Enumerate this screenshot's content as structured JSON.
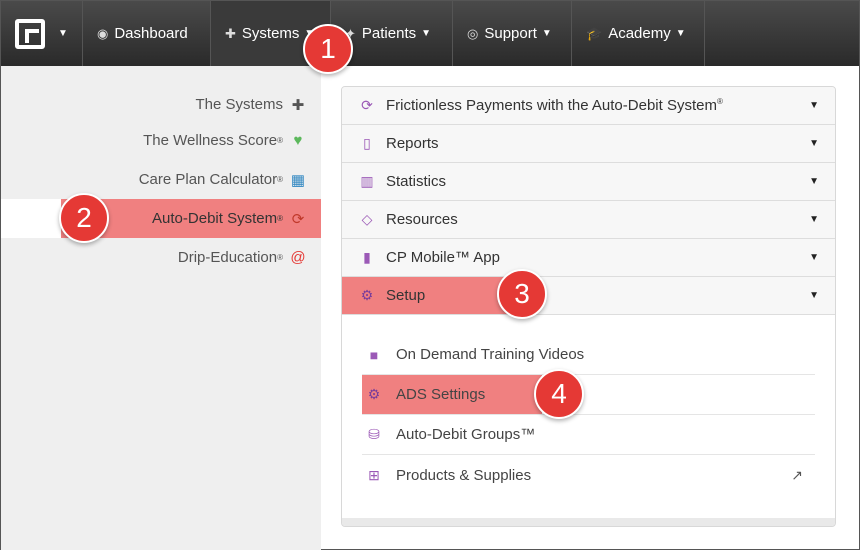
{
  "topnav": {
    "items": [
      {
        "icon": "dashboard-icon",
        "label": "Dashboard"
      },
      {
        "icon": "puzzle-icon",
        "label": "Systems"
      },
      {
        "icon": "people-icon",
        "label": "Patients"
      },
      {
        "icon": "lifebuoy-icon",
        "label": "Support"
      },
      {
        "icon": "graduation-cap-icon",
        "label": "Academy"
      }
    ]
  },
  "sidebar": {
    "items": [
      {
        "label": "The Systems",
        "icon": "puzzle-icon",
        "icon_color": "#555555"
      },
      {
        "label": "The Wellness Score",
        "icon": "heartbeat-icon",
        "icon_color": "#5cb85c"
      },
      {
        "label": "Care Plan Calculator",
        "icon": "calculator-icon",
        "icon_color": "#2e86c1"
      },
      {
        "label": "Auto-Debit System",
        "icon": "refresh-icon",
        "icon_color": "#e53935"
      },
      {
        "label": "Drip-Education",
        "icon": "at-icon",
        "icon_color": "#e53935"
      }
    ]
  },
  "accordion": {
    "rows": [
      {
        "label": "Frictionless Payments with the Auto-Debit System",
        "icon": "refresh-icon"
      },
      {
        "label": "Reports",
        "icon": "document-icon"
      },
      {
        "label": "Statistics",
        "icon": "bar-chart-icon"
      },
      {
        "label": "Resources",
        "icon": "diamond-icon"
      },
      {
        "label": "CP Mobile™ App",
        "icon": "mobile-icon"
      },
      {
        "label": "Setup",
        "icon": "gears-icon"
      }
    ],
    "setup_items": [
      {
        "label": "On Demand Training Videos",
        "icon": "video-camera-icon"
      },
      {
        "label": "ADS Settings",
        "icon": "gear-icon"
      },
      {
        "label": "Auto-Debit Groups™",
        "icon": "database-icon"
      },
      {
        "label": "Products & Supplies",
        "icon": "basket-icon"
      }
    ]
  },
  "badges": [
    "1",
    "2",
    "3",
    "4"
  ],
  "colors": {
    "highlight": "#f08080",
    "badge": "#e53935",
    "accent": "#9b59b6"
  }
}
